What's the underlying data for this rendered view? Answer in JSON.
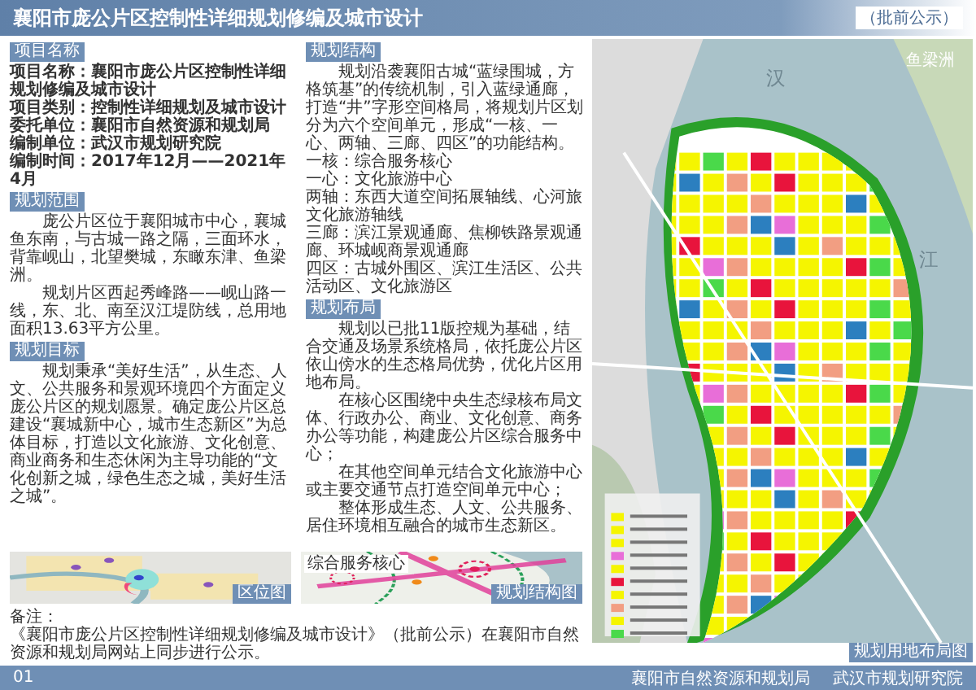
{
  "header": {
    "title": "襄阳市庞公片区控制性详细规划修编及城市设计",
    "badge": "（批前公示）"
  },
  "project": {
    "heading": "项目名称",
    "lines": [
      "项目名称：襄阳市庞公片区控制性详细规划修编及城市设计",
      "项目类别：控制性详细规划及城市设计",
      "委托单位：襄阳市自然资源和规划局",
      "编制单位：武汉市规划研究院",
      "编制时间：2017年12月——2021年4月"
    ]
  },
  "scope": {
    "heading": "规划范围",
    "paragraphs": [
      "庞公片区位于襄阳城市中心，襄城鱼东南，与古城一路之隔，三面环水，背靠岘山，北望樊城，东瞰东津、鱼梁洲。",
      "规划片区西起秀峰路——岘山路一线，东、北、南至汉江堤防线，总用地面积13.63平方公里。"
    ]
  },
  "goal": {
    "heading": "规划目标",
    "paragraphs": [
      "规划秉承“美好生活”，从生态、人文、公共服务和景观环境四个方面定义庞公片区的规划愿景。确定庞公片区总建设“襄城新中心，城市生态新区”为总体目标，打造以文化旅游、文化创意、商业商务和生态休闲为主导功能的“文化创新之城，绿色生态之城，美好生活之城”。"
    ]
  },
  "structure": {
    "heading": "规划结构",
    "paragraphs": [
      "规划沿袭襄阳古城“蓝绿围城，方格筑基”的传统机制，引入蓝绿通廊，打造“井”字形空间格局，将规划片区划分为六个空间单元，形成“一核、一心、两轴、三廊、四区”的功能结构。"
    ],
    "items": [
      "一核：综合服务核心",
      "一心：文化旅游中心",
      "两轴：东西大道空间拓展轴线、心河旅文化旅游轴线",
      "三廊：滨江景观通廊、焦柳铁路景观通廊、环城岘商景观通廊",
      "四区：古城外围区、滨江生活区、公共活动区、文化旅游区"
    ]
  },
  "layout": {
    "heading": "规划布局",
    "paragraphs": [
      "规划以已批11版控规为基础，结合交通及场景系统格局，依托庞公片区依山傍水的生态格局优势，优化片区用地布局。",
      "在核心区围绕中央生态绿核布局文体、行政办公、商业、文化创意、商务办公等功能，构建庞公片区综合服务中心；",
      "在其他空间单元结合文化旅游中心或主要交通节点打造空间单元中心；",
      "整体形成生态、人文、公共服务、居住环境相互融合的城市生态新区。"
    ]
  },
  "location_map": {
    "caption": "区位图"
  },
  "structure_map": {
    "caption": "规划结构图",
    "labels": [
      "综合服务核心"
    ]
  },
  "landuse_map": {
    "caption": "规划用地布局图",
    "labels": [
      "汉",
      "江",
      "鱼梁洲"
    ]
  },
  "notes": {
    "title": "备注：",
    "text": "《襄阳市庞公片区控制性详细规划修编及城市设计》（批前公示）在襄阳市自然资源和规划局网站上同步进行公示。"
  },
  "footer": {
    "page": "01",
    "orgs": [
      "襄阳市自然资源和规划局",
      "武汉市规划研究院"
    ]
  }
}
